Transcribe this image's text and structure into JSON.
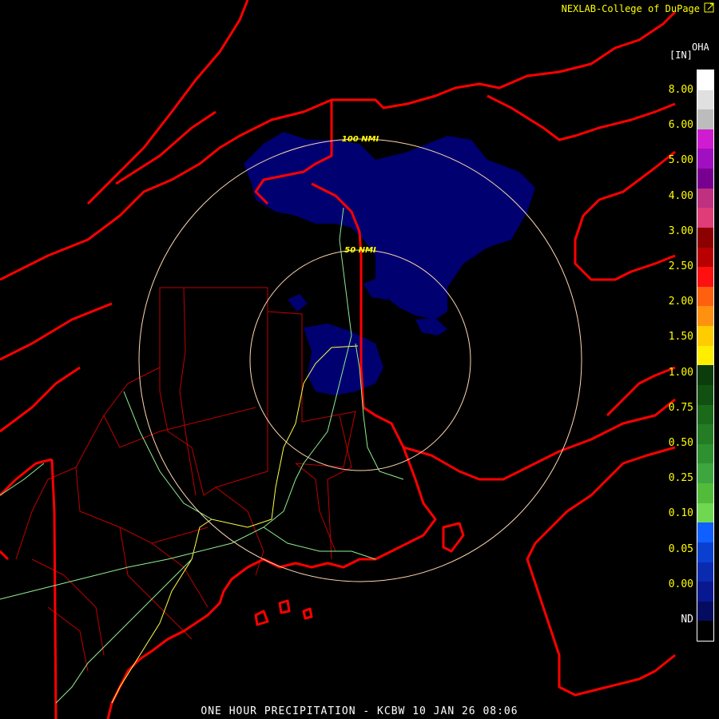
{
  "header": {
    "credit": "NEXLAB-College of DuPage"
  },
  "legend": {
    "unit": "[IN]",
    "product": "OHA",
    "labels": [
      "8.00",
      "6.00",
      "5.00",
      "4.00",
      "3.00",
      "2.50",
      "2.00",
      "1.50",
      "1.00",
      "0.75",
      "0.50",
      "0.25",
      "0.10",
      "0.05",
      "0.00",
      "ND"
    ],
    "colors": [
      "#ffffff",
      "#e0e0e0",
      "#bcbcbc",
      "#d01cd0",
      "#a010c0",
      "#780090",
      "#c03080",
      "#e03c78",
      "#8c0000",
      "#b80000",
      "#ff1010",
      "#ff6010",
      "#ff9010",
      "#ffcc00",
      "#ffee00",
      "#0c3c0c",
      "#105010",
      "#1a6a1a",
      "#247c24",
      "#2e902e",
      "#3ea63e",
      "#52bc3a",
      "#70d850",
      "#1060ff",
      "#0a40d0",
      "#0a2ab0",
      "#081890",
      "#040c60",
      "#000000"
    ]
  },
  "radar": {
    "rings": [
      {
        "label": "50 NMI",
        "nmi": 50
      },
      {
        "label": "100 NMI",
        "nmi": 100
      }
    ],
    "precip_color": "#000070"
  },
  "footer": {
    "title": "ONE HOUR PRECIPITATION - KCBW 10 JAN 26 08:06"
  }
}
